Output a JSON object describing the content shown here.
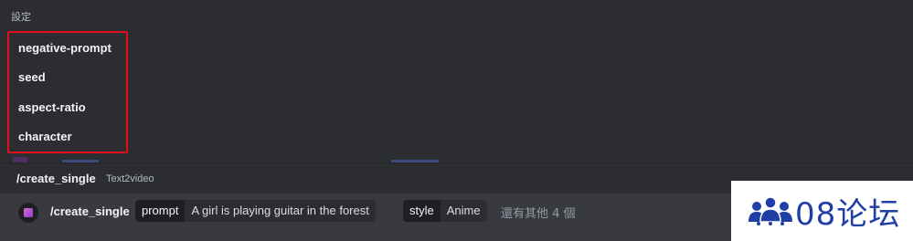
{
  "popup": {
    "section_label": "設定",
    "options": [
      "negative-prompt",
      "seed",
      "aspect-ratio",
      "character"
    ]
  },
  "command_header": {
    "name": "/create_single",
    "description": "Text2video"
  },
  "input": {
    "command": "/create_single",
    "params": [
      {
        "key": "prompt",
        "value": "A girl is playing guitar in the forest"
      },
      {
        "key": "style",
        "value": "Anime"
      }
    ],
    "more_text": "還有其他 4 個"
  },
  "watermark": {
    "text": "08论坛",
    "color": "#1f3fa6"
  },
  "colors": {
    "highlight_border": "#e0101a",
    "background": "#313338"
  }
}
